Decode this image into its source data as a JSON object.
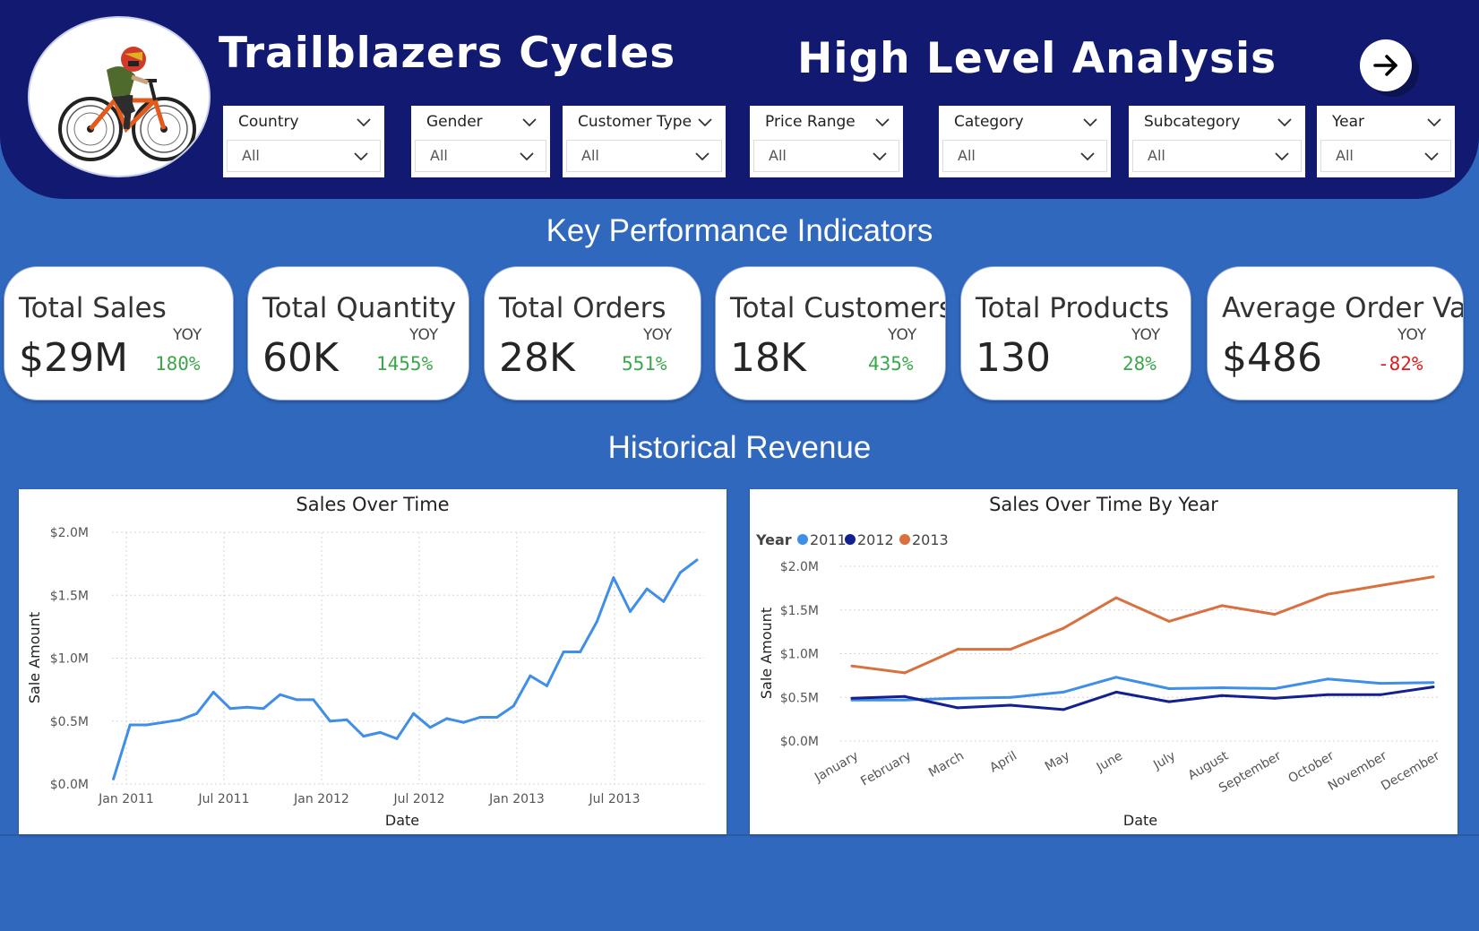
{
  "header": {
    "app_title": "Trailblazers Cycles",
    "page_title": "High Level Analysis",
    "nav_icon": "arrow-right-icon",
    "logo_icon": "cyclist-icon"
  },
  "slicers": [
    {
      "label": "Country",
      "value": "All"
    },
    {
      "label": "Gender",
      "value": "All"
    },
    {
      "label": "Customer Type",
      "value": "All"
    },
    {
      "label": "Price Range",
      "value": "All"
    },
    {
      "label": "Category",
      "value": "All"
    },
    {
      "label": "Subcategory",
      "value": "All"
    },
    {
      "label": "Year",
      "value": "All"
    }
  ],
  "sections": {
    "kpi_title": "Key Performance Indicators",
    "revenue_title": "Historical Revenue"
  },
  "kpis": [
    {
      "name": "Total Sales",
      "yoy_label": "YOY",
      "value": "$29M",
      "yoy": "180%",
      "trend": "up"
    },
    {
      "name": "Total Quantity",
      "yoy_label": "YOY",
      "value": "60K",
      "yoy": "1455%",
      "trend": "up"
    },
    {
      "name": "Total Orders",
      "yoy_label": "YOY",
      "value": "28K",
      "yoy": "551%",
      "trend": "up"
    },
    {
      "name": "Total Customers",
      "yoy_label": "YOY",
      "value": "18K",
      "yoy": "435%",
      "trend": "up"
    },
    {
      "name": "Total Products",
      "yoy_label": "YOY",
      "value": "130",
      "yoy": "28%",
      "trend": "up"
    },
    {
      "name": "Average Order Val",
      "yoy_label": "YOY",
      "value": "$486",
      "yoy": "-82%",
      "trend": "down"
    }
  ],
  "colors": {
    "positive": "#3aa84a",
    "negative": "#e01b1b",
    "series_2011": "#3f8ee8",
    "series_2012": "#14208f",
    "series_2013": "#d9703f",
    "header_bg": "#111a70",
    "page_bg": "#3068bd"
  },
  "chart_data": [
    {
      "type": "line",
      "title": "Sales Over Time",
      "xlabel": "Date",
      "ylabel": "Sale Amount",
      "x_ticks": [
        "Jan 2011",
        "Jul 2011",
        "Jan 2012",
        "Jul 2012",
        "Jan 2013",
        "Jul 2013"
      ],
      "y_ticks": [
        "$0.0M",
        "$0.5M",
        "$1.0M",
        "$1.5M",
        "$2.0M"
      ],
      "ylim": [
        0,
        2.0
      ],
      "grid": true,
      "x": [
        "2010-12",
        "2011-01",
        "2011-02",
        "2011-03",
        "2011-04",
        "2011-05",
        "2011-06",
        "2011-07",
        "2011-08",
        "2011-09",
        "2011-10",
        "2011-11",
        "2011-12",
        "2012-01",
        "2012-02",
        "2012-03",
        "2012-04",
        "2012-05",
        "2012-06",
        "2012-07",
        "2012-08",
        "2012-09",
        "2012-10",
        "2012-11",
        "2012-12",
        "2013-01",
        "2013-02",
        "2013-03",
        "2013-04",
        "2013-05",
        "2013-06",
        "2013-07",
        "2013-08",
        "2013-09",
        "2013-10",
        "2013-11"
      ],
      "values": [
        0.04,
        0.47,
        0.47,
        0.49,
        0.51,
        0.56,
        0.73,
        0.6,
        0.61,
        0.6,
        0.71,
        0.67,
        0.67,
        0.5,
        0.51,
        0.38,
        0.41,
        0.36,
        0.56,
        0.45,
        0.52,
        0.49,
        0.53,
        0.53,
        0.62,
        0.86,
        0.78,
        1.05,
        1.05,
        1.29,
        1.64,
        1.37,
        1.55,
        1.45,
        1.68,
        1.78
      ]
    },
    {
      "type": "line",
      "title": "Sales Over Time By Year",
      "xlabel": "Date",
      "ylabel": "Sale Amount",
      "legend_title": "Year",
      "legend_position": "top-left",
      "categories": [
        "January",
        "February",
        "March",
        "April",
        "May",
        "June",
        "July",
        "August",
        "September",
        "October",
        "November",
        "December"
      ],
      "y_ticks": [
        "$0.0M",
        "$0.5M",
        "$1.0M",
        "$1.5M",
        "$2.0M"
      ],
      "ylim": [
        0,
        2.0
      ],
      "grid": true,
      "series": [
        {
          "name": "2011",
          "values": [
            0.47,
            0.47,
            0.49,
            0.5,
            0.56,
            0.73,
            0.6,
            0.61,
            0.6,
            0.71,
            0.66,
            0.67
          ]
        },
        {
          "name": "2012",
          "values": [
            0.49,
            0.51,
            0.38,
            0.41,
            0.36,
            0.56,
            0.45,
            0.52,
            0.49,
            0.53,
            0.53,
            0.62
          ]
        },
        {
          "name": "2013",
          "values": [
            0.86,
            0.78,
            1.05,
            1.05,
            1.29,
            1.64,
            1.37,
            1.55,
            1.45,
            1.68,
            1.78,
            1.88
          ]
        }
      ]
    }
  ]
}
